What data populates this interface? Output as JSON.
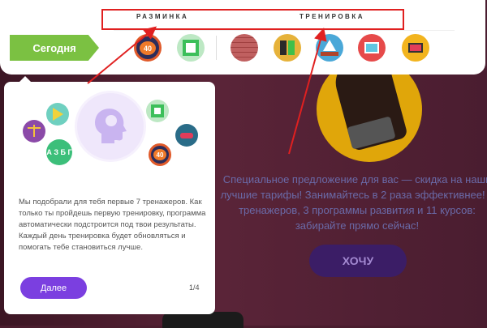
{
  "topbar": {
    "today_label": "Сегодня",
    "tab_warmup": "РАЗМИНКА",
    "tab_training": "ТРЕНИРОВКА",
    "warmup_icons": [
      "timer-40-icon",
      "green-square-icon"
    ],
    "training_icons": [
      "brick-wall-icon",
      "color-blocks-icon",
      "ship-icon",
      "photo-icon",
      "tv-icon"
    ],
    "timer_text": "40"
  },
  "popup": {
    "text": "Мы подобрали для тебя первые 7 тренажеров. Как только ты пройдешь первую тренировку, программа автоматически подстроится под твои результаты. Каждый день тренировка будет обновляться и помогать тебе становиться лучше.",
    "next_label": "Далее",
    "pager": "1/4",
    "timer_text": "40",
    "letters_text": "А З Б Г"
  },
  "background": {
    "offer_text": "Специальное предложение для вас — скидка на наши лучшие тарифы! Занимайтесь в 2 раза эффективнее! 7 тренажеров, 3 программы развития и 11 курсов: забирайте прямо сейчас!",
    "button_label": "ХОЧУ"
  },
  "colors": {
    "accent": "#7b3fe0",
    "green": "#7bc142",
    "annotation": "#e02020"
  }
}
